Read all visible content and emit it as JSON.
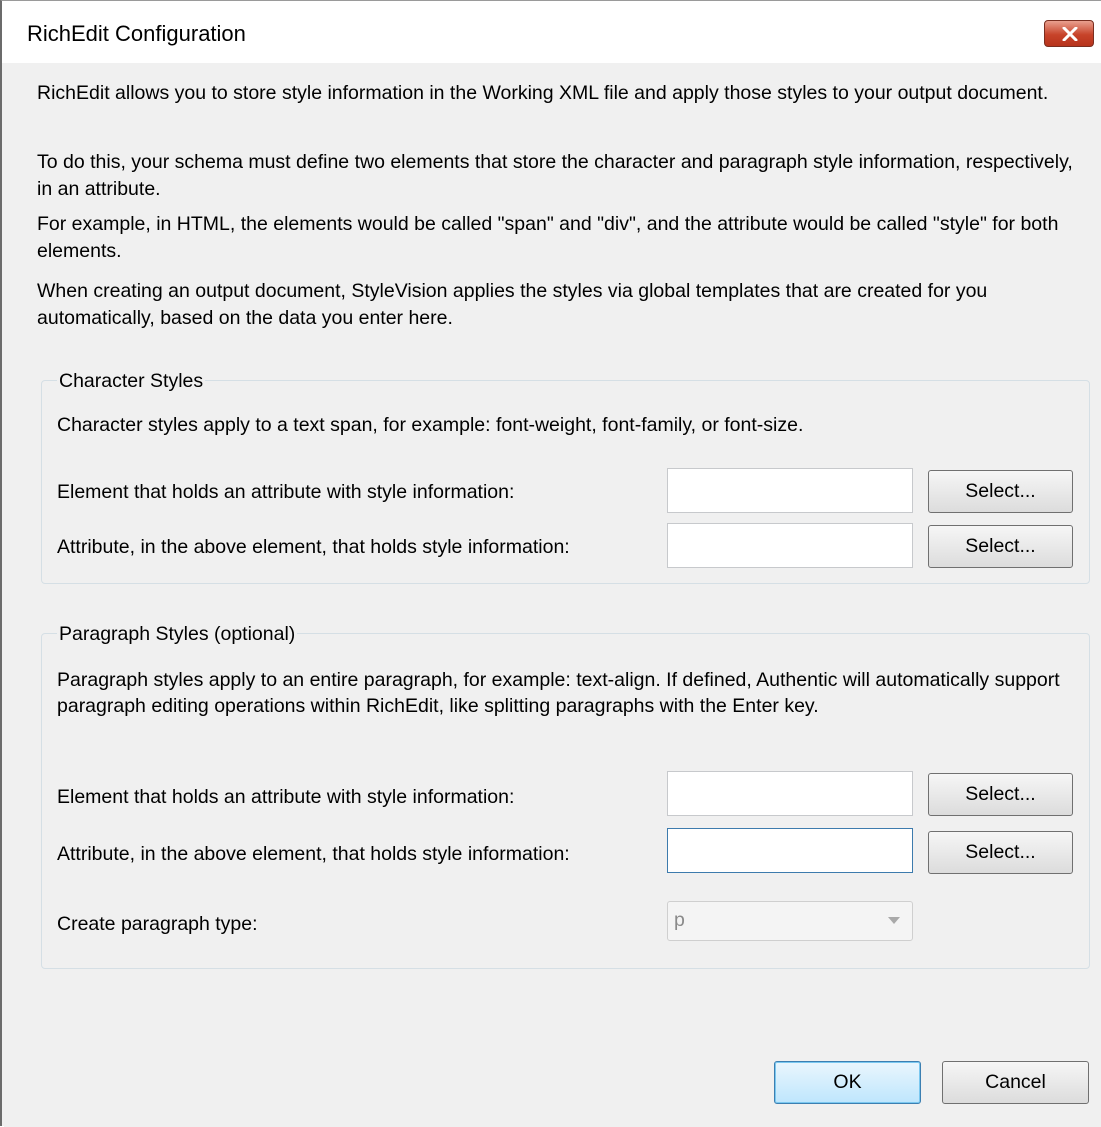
{
  "window": {
    "title": "RichEdit Configuration"
  },
  "intro": [
    "RichEdit allows you to store style information in the Working XML file and apply those styles to your output document.",
    "To do this, your schema must define two elements that store the character and paragraph style information, respectively, in an attribute.",
    "For example, in HTML, the elements would be called \"span\" and \"div\", and the attribute would be called \"style\" for both elements.",
    "When creating an output document, StyleVision applies the styles via global templates that are created for you automatically, based on the data you enter here."
  ],
  "character_styles": {
    "title": "Character Styles",
    "description": "Character styles apply to a text span, for example: font-weight, font-family, or font-size.",
    "element_label": "Element that holds an attribute with style information:",
    "element_value": "",
    "attribute_label": "Attribute, in the above element, that holds style information:",
    "attribute_value": "",
    "select_label": "Select..."
  },
  "paragraph_styles": {
    "title": "Paragraph Styles (optional)",
    "description": "Paragraph styles apply to an entire paragraph, for example: text-align. If defined, Authentic will automatically support paragraph editing operations within RichEdit, like splitting paragraphs with the Enter key.",
    "element_label": "Element that holds an attribute with style information:",
    "element_value": "",
    "attribute_label": "Attribute, in the above element, that holds style information:",
    "attribute_value": "",
    "select_label": "Select...",
    "paragraph_type_label": "Create paragraph type:",
    "paragraph_type_value": "p"
  },
  "buttons": {
    "ok": "OK",
    "cancel": "Cancel"
  },
  "colors": {
    "close_button": "#c7432a",
    "dialog_bg": "#f0f0f0",
    "ok_border": "#3c7fb1"
  }
}
